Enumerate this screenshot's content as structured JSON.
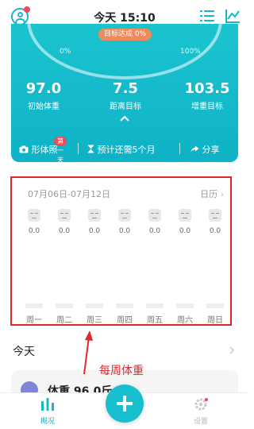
{
  "header": {
    "title": "今天 15:10"
  },
  "hero": {
    "tag": "目标达成 0%",
    "pct_start": "0%",
    "pct_end": "100%",
    "stats": [
      {
        "value": "97.0",
        "label": "初始体重"
      },
      {
        "value": "7.5",
        "label": "距离目标"
      },
      {
        "value": "103.5",
        "label": "增重目标"
      }
    ],
    "photo_label": "形体照",
    "photo_badge": "第一天",
    "estimate": "预计还需5个月",
    "share": "分享"
  },
  "week": {
    "range": "07月06日-07月12日",
    "calendar": "日历",
    "days": [
      {
        "label": "周一",
        "value": "0.0"
      },
      {
        "label": "周二",
        "value": "0.0"
      },
      {
        "label": "周三",
        "value": "0.0"
      },
      {
        "label": "周四",
        "value": "0.0"
      },
      {
        "label": "周五",
        "value": "0.0"
      },
      {
        "label": "周六",
        "value": "0.0"
      },
      {
        "label": "周日",
        "value": "0.0"
      }
    ]
  },
  "annotation": "每周体重",
  "today": {
    "title": "今天",
    "record": "体重 96.0斤"
  },
  "nav": {
    "overview": "概况",
    "settings": "设置"
  },
  "colors": {
    "accent": "#16b8c8",
    "alert": "#e0262b"
  }
}
